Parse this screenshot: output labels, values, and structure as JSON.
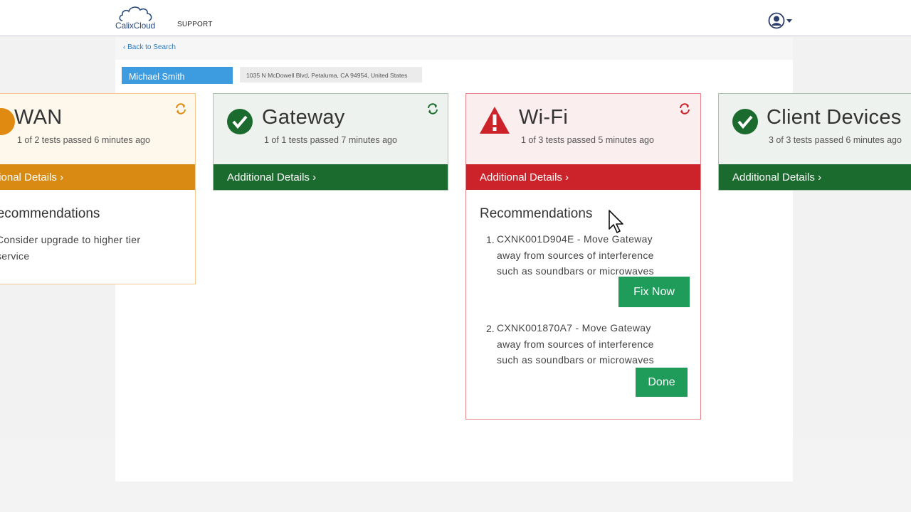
{
  "header": {
    "logo_text": "CalixCloud",
    "nav_support": "SUPPORT"
  },
  "subscriber": {
    "back_link": "Back to Search",
    "name": "Michael Smith",
    "address": "1035 N McDowell Blvd, Petaluma, CA 94954, United States"
  },
  "cards": {
    "wan": {
      "title": "WAN",
      "subtitle": "1 of 2 tests passed 6 minutes ago",
      "details": "Additional Details ›",
      "rec_title": "Recommendations",
      "rec_1": "Consider upgrade to higher tier service",
      "status": "warning",
      "color": "#d98a12"
    },
    "gateway": {
      "title": "Gateway",
      "subtitle": "1 of 1 tests passed 7 minutes ago",
      "details": "Additional Details ›",
      "status": "pass",
      "color": "#1c6b2e"
    },
    "wifi": {
      "title": "Wi-Fi",
      "subtitle": "1 of 3 tests passed 5 minutes ago",
      "details": "Additional Details ›",
      "rec_title": "Recommendations",
      "rec_1_num": "1.",
      "rec_1": "CXNK001D904E - Move Gateway away from sources of interference such as soundbars or microwaves",
      "rec_1_button": "Fix Now",
      "rec_2_num": "2.",
      "rec_2": "CXNK001870A7 - Move Gateway away from sources of interference such as soundbars or microwaves",
      "rec_2_button": "Done",
      "status": "fail",
      "color": "#cc2229"
    },
    "client_devices": {
      "title": "Client Devices",
      "subtitle": "3 of 3 tests passed 6 minutes ago",
      "details": "Additional Details ›",
      "status": "pass",
      "color": "#1c6b2e"
    }
  },
  "icons": {
    "logo": "cloud-logo-icon",
    "user": "user-avatar-icon",
    "refresh": "refresh-icon",
    "pass": "checkmark-circle-icon",
    "fail": "warning-triangle-icon",
    "warning": "warning-circle-icon"
  }
}
